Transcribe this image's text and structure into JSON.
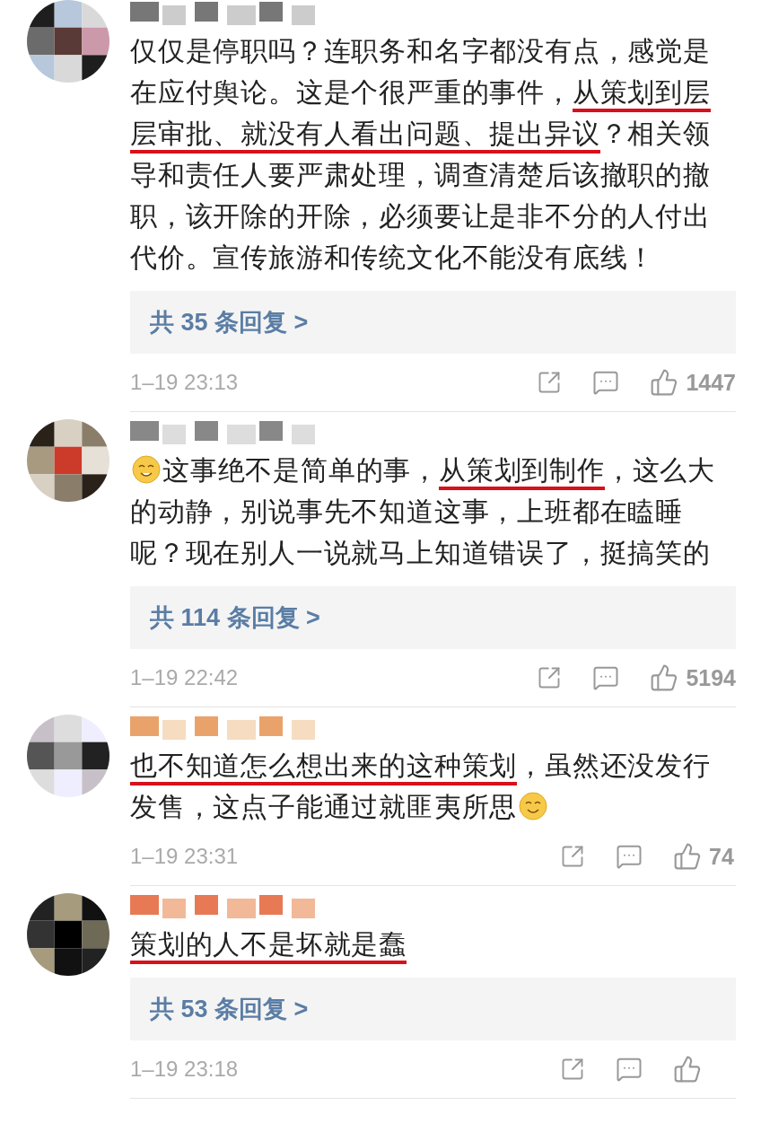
{
  "comments": [
    {
      "segments": [
        {
          "kind": "text",
          "text": "仅仅是停职吗？连职务和名字都没有点，感觉是在应付舆论。这是个很严重的事件，",
          "underlined": false
        },
        {
          "kind": "text",
          "text": "从策划到层层审批、就没有人看出问题、提出异议",
          "underlined": true
        },
        {
          "kind": "text",
          "text": "？相关领导和责任人要严肃处理，调查清楚后该撤职的撤职，该开除的开除，必须要让是非不分的人付出代价。宣传旅游和传统文化不能没有底线！",
          "underlined": false
        }
      ],
      "replies": "共 35 条回复 >",
      "time": "1–19 23:13",
      "likes": "1447"
    },
    {
      "segments": [
        {
          "kind": "emoji"
        },
        {
          "kind": "text",
          "text": "这事绝不是简单的事，",
          "underlined": false
        },
        {
          "kind": "text",
          "text": "从策划到制作",
          "underlined": true
        },
        {
          "kind": "text",
          "text": "，这么大的动静，别说事先不知道这事，上班都在瞌睡呢？现在别人一说就马上知道错误了，挺搞笑的",
          "underlined": false
        }
      ],
      "replies": "共 114 条回复 >",
      "time": "1–19 22:42",
      "likes": "5194"
    },
    {
      "segments": [
        {
          "kind": "text",
          "text": "也不知道怎么想出来的这种策划",
          "underlined": true
        },
        {
          "kind": "text",
          "text": "，虽然还没发行发售，这点子能通过就匪夷所思",
          "underlined": false
        },
        {
          "kind": "emoji"
        }
      ],
      "time": "1–19 23:31",
      "likes": "74"
    },
    {
      "segments": [
        {
          "kind": "text",
          "text": "策划的人不是坏就是蠢",
          "underlined": true
        }
      ],
      "replies": "共 53 条回复 >",
      "time": "1–19 23:18"
    }
  ]
}
